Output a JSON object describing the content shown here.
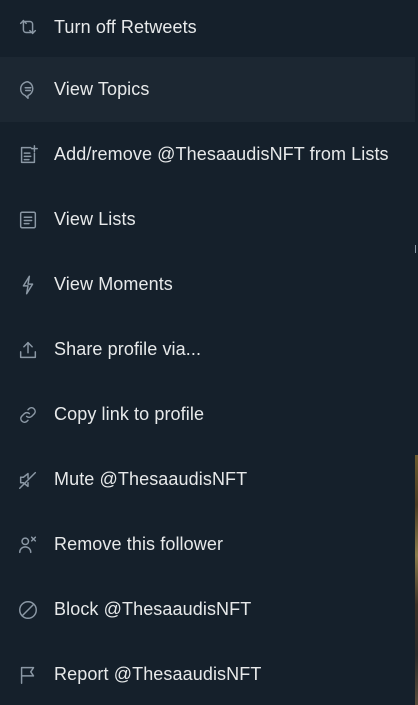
{
  "menu": {
    "items": [
      {
        "label": "Turn off Retweets",
        "icon": "retweet-icon"
      },
      {
        "label": "View Topics",
        "icon": "topic-bubble-icon"
      },
      {
        "label": "Add/remove @ThesaaudisNFT from Lists",
        "icon": "list-add-icon"
      },
      {
        "label": "View Lists",
        "icon": "list-icon"
      },
      {
        "label": "View Moments",
        "icon": "lightning-icon"
      },
      {
        "label": "Share profile via...",
        "icon": "share-icon"
      },
      {
        "label": "Copy link to profile",
        "icon": "link-icon"
      },
      {
        "label": "Mute @ThesaaudisNFT",
        "icon": "mute-speaker-icon"
      },
      {
        "label": "Remove this follower",
        "icon": "remove-person-icon"
      },
      {
        "label": "Block @ThesaaudisNFT",
        "icon": "block-icon"
      },
      {
        "label": "Report @ThesaaudisNFT",
        "icon": "flag-icon"
      }
    ]
  },
  "colors": {
    "background": "#15202b",
    "hover": "#1c2732",
    "text": "#e7e9ea",
    "icon": "#8b98a5"
  }
}
